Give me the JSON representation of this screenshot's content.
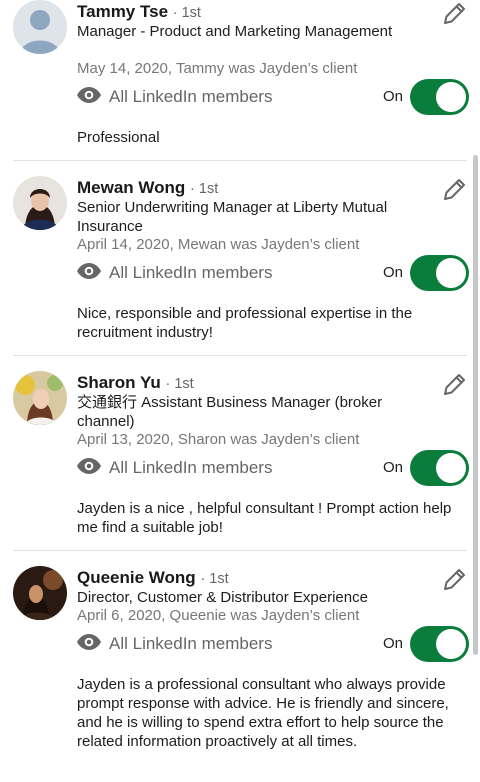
{
  "visibility_label": "All LinkedIn members",
  "toggle_label": "On",
  "colors": {
    "toggle_on": "#0a7d3c",
    "name": "#191919",
    "meta": "#777777"
  },
  "recommendations": [
    {
      "name": "Tammy Tse",
      "degree": "· 1st",
      "headline": "Manager - Product and Marketing Management",
      "date": "May 14, 2020, Tammy was Jayden’s client",
      "message": "Professional",
      "visibility_enabled": true
    },
    {
      "name": "Mewan Wong",
      "degree": "· 1st",
      "headline": "Senior Underwriting Manager at Liberty Mutual Insurance",
      "date": "April 14, 2020, Mewan was Jayden’s client",
      "message": "Nice, responsible and professional expertise in the recruitment industry!",
      "visibility_enabled": true
    },
    {
      "name": "Sharon Yu",
      "degree": "· 1st",
      "headline": "交通銀行 Assistant Business Manager (broker channel)",
      "date": "April 13, 2020, Sharon was Jayden’s client",
      "message": "Jayden is a nice , helpful consultant ! Prompt action help me find a suitable job!",
      "visibility_enabled": true
    },
    {
      "name": "Queenie Wong",
      "degree": "· 1st",
      "headline": "Director, Customer & Distributor Experience",
      "date": "April 6, 2020, Queenie was Jayden’s client",
      "message": "Jayden is a professional consultant who always provide prompt response with advice.  He is friendly and sincere, and he is willing to spend extra effort to help source the related information proactively at all times.",
      "visibility_enabled": true
    }
  ]
}
